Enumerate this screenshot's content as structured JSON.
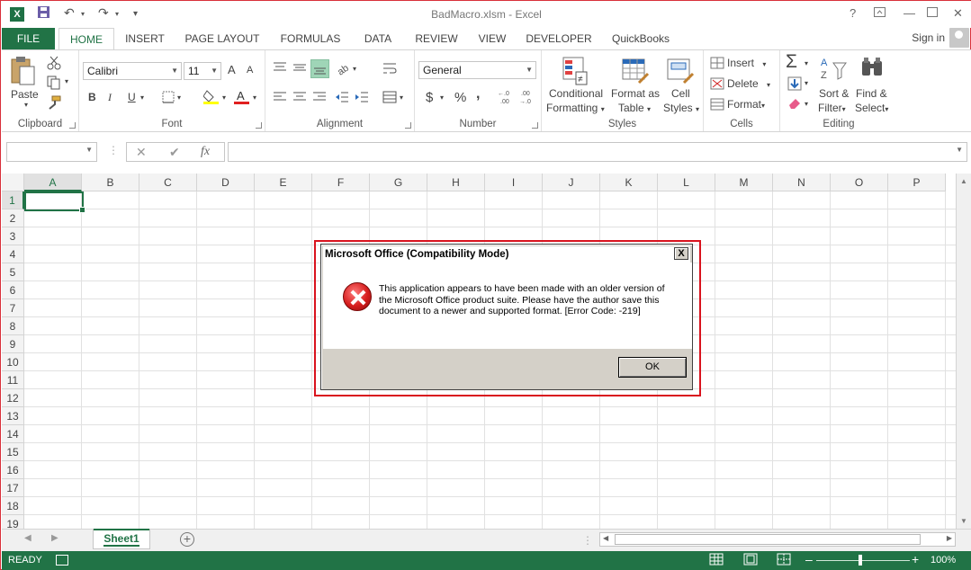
{
  "window": {
    "title": "BadMacro.xlsm - Excel",
    "app_icon": "X",
    "help": "?",
    "controls": [
      "≡",
      "—",
      "☐",
      "✕"
    ]
  },
  "quick_access": {
    "save": "💾",
    "undo": "↶",
    "redo": "↷",
    "more": "≡"
  },
  "tabs": {
    "file": "FILE",
    "items": [
      "HOME",
      "INSERT",
      "PAGE LAYOUT",
      "FORMULAS",
      "DATA",
      "REVIEW",
      "VIEW",
      "DEVELOPER",
      "QuickBooks"
    ],
    "active": "HOME",
    "sign_in": "Sign in"
  },
  "ribbon": {
    "clipboard": {
      "label": "Clipboard",
      "paste": "Paste"
    },
    "font": {
      "label": "Font",
      "name": "Calibri",
      "size": "11",
      "bold": "B",
      "italic": "I",
      "underline": "U",
      "grow": "A",
      "shrink": "A"
    },
    "alignment": {
      "label": "Alignment"
    },
    "number": {
      "label": "Number",
      "format": "General",
      "currency": "$",
      "percent": "%",
      "comma": ",",
      "inc_dec": ".0→.00",
      "dec_dec": ".00→.0"
    },
    "styles": {
      "label": "Styles",
      "conditional_line1": "Conditional",
      "conditional_line2": "Formatting",
      "format_as_line1": "Format as",
      "format_as_line2": "Table",
      "cell_line1": "Cell",
      "cell_line2": "Styles"
    },
    "cells": {
      "label": "Cells",
      "insert": "Insert",
      "delete": "Delete",
      "format": "Format"
    },
    "editing": {
      "label": "Editing",
      "sort_line1": "Sort &",
      "sort_line2": "Filter",
      "find_line1": "Find &",
      "find_line2": "Select"
    },
    "accent": "#217346"
  },
  "formula_bar": {
    "cancel": "✕",
    "enter": "✔",
    "fx": "fx",
    "name_box": "",
    "value": ""
  },
  "grid": {
    "columns": [
      "A",
      "B",
      "C",
      "D",
      "E",
      "F",
      "G",
      "H",
      "I",
      "J",
      "K",
      "L",
      "M",
      "N",
      "O",
      "P"
    ],
    "rows": [
      "1",
      "2",
      "3",
      "4",
      "5",
      "6",
      "7",
      "8",
      "9",
      "10",
      "11",
      "12",
      "13",
      "14",
      "15",
      "16",
      "17",
      "18",
      "19"
    ],
    "active_cell": "A1"
  },
  "sheets": {
    "tabs": [
      "Sheet1"
    ],
    "add": "+"
  },
  "status": {
    "ready": "READY",
    "zoom": "100%",
    "minus": "–",
    "plus": "+"
  },
  "dialog": {
    "title": "Microsoft Office (Compatibility Mode)",
    "close": "X",
    "message": "This application appears to have been made with an older version of the Microsoft Office product suite. Please have the author save this document to a newer and supported format. [Error Code: -219]",
    "ok": "OK",
    "highlight_color": "#d9131e"
  }
}
